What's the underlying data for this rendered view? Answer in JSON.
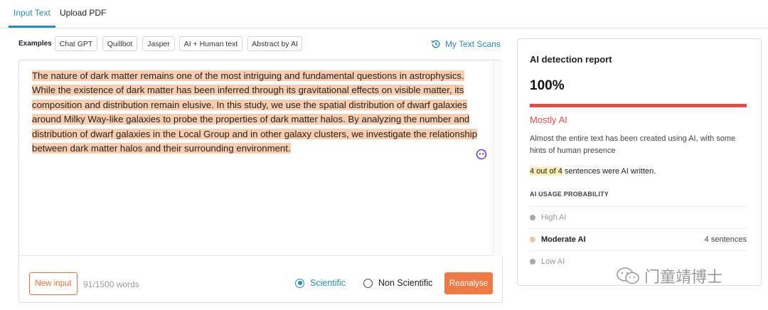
{
  "tabs": [
    {
      "label": "Input Text",
      "active": true
    },
    {
      "label": "Upload PDF",
      "active": false
    }
  ],
  "examples": {
    "label": "Examples",
    "chips": [
      "Chat GPT",
      "Quillbot",
      "Jasper",
      "AI + Human text",
      "Abstract by AI"
    ]
  },
  "scans_link": {
    "label": "My Text Scans",
    "icon": "history-icon"
  },
  "editor": {
    "segments": [
      "The nature of dark matter remains one of the most intriguing and fundamental questions in astrophysics.",
      " While the existence of dark matter has been inferred through its gravitational effects on visible matter, its composition and distribution remain elusive.",
      " In this study, we use the spatial distribution of dwarf galaxies around Milky Way-like galaxies to probe the properties of dark matter halos.",
      " By analyzing the number and distribution of dwarf galaxies in the Local Group and in other galaxy clusters, we investigate the relationship between dark matter halos and their surrounding environment."
    ],
    "highlight_color": "#f8cdb0",
    "new_input_label": "New input",
    "word_count": "91/1500 words",
    "modes": [
      {
        "label": "Scientific",
        "selected": true
      },
      {
        "label": "Non Scientific",
        "selected": false
      }
    ],
    "reanalyse_label": "Reanalyse"
  },
  "report": {
    "title": "AI detection report",
    "score": "100%",
    "score_fraction": 1.0,
    "verdict": "Mostly AI",
    "description": "Almost the entire text has been created using AI, with some hints of human presence",
    "sentences_highlight": "4 out of 4",
    "sentences_rest": " sentences were AI written.",
    "usage_header": "AI USAGE PROBABILITY",
    "usage_rows": [
      {
        "label": "High AI",
        "count": "",
        "color": "#a8a8a8",
        "active": false
      },
      {
        "label": "Moderate AI",
        "count": "4 sentences",
        "color": "#f4c4a6",
        "active": true
      },
      {
        "label": "Low AI",
        "count": "",
        "color": "#a8a8a8",
        "active": false
      }
    ]
  },
  "watermark": {
    "text": "门童靖博士"
  },
  "colors": {
    "accent_blue": "#2a8fb5",
    "accent_orange": "#ef7a45",
    "danger_red": "#e0504a"
  }
}
